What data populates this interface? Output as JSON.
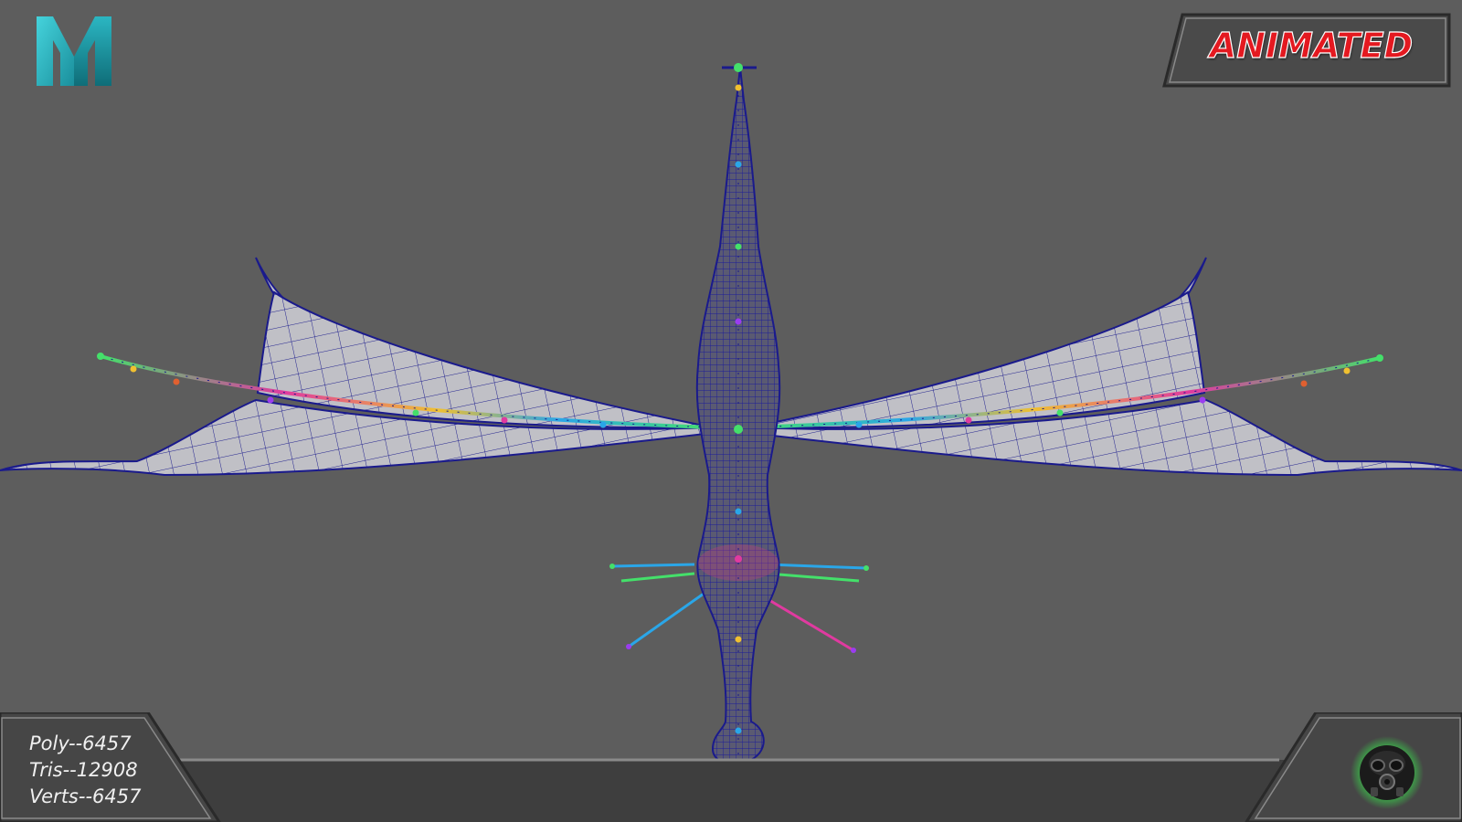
{
  "app": {
    "logo_icon": "maya-logo-icon",
    "accent_color": "#2bb6c2"
  },
  "badge": {
    "label": "ANIMATED",
    "text_color": "#e41920"
  },
  "stats": {
    "poly": "Poly--6457",
    "tris": "Tris--12908",
    "verts": "Verts--6457"
  },
  "viewport": {
    "background": "#5d5d5d",
    "wireframe_color": "#1a1a8c",
    "mesh_fill": "#c0c0c6"
  },
  "brand": {
    "icon": "gas-mask-icon",
    "glow_color": "#37e64a"
  }
}
